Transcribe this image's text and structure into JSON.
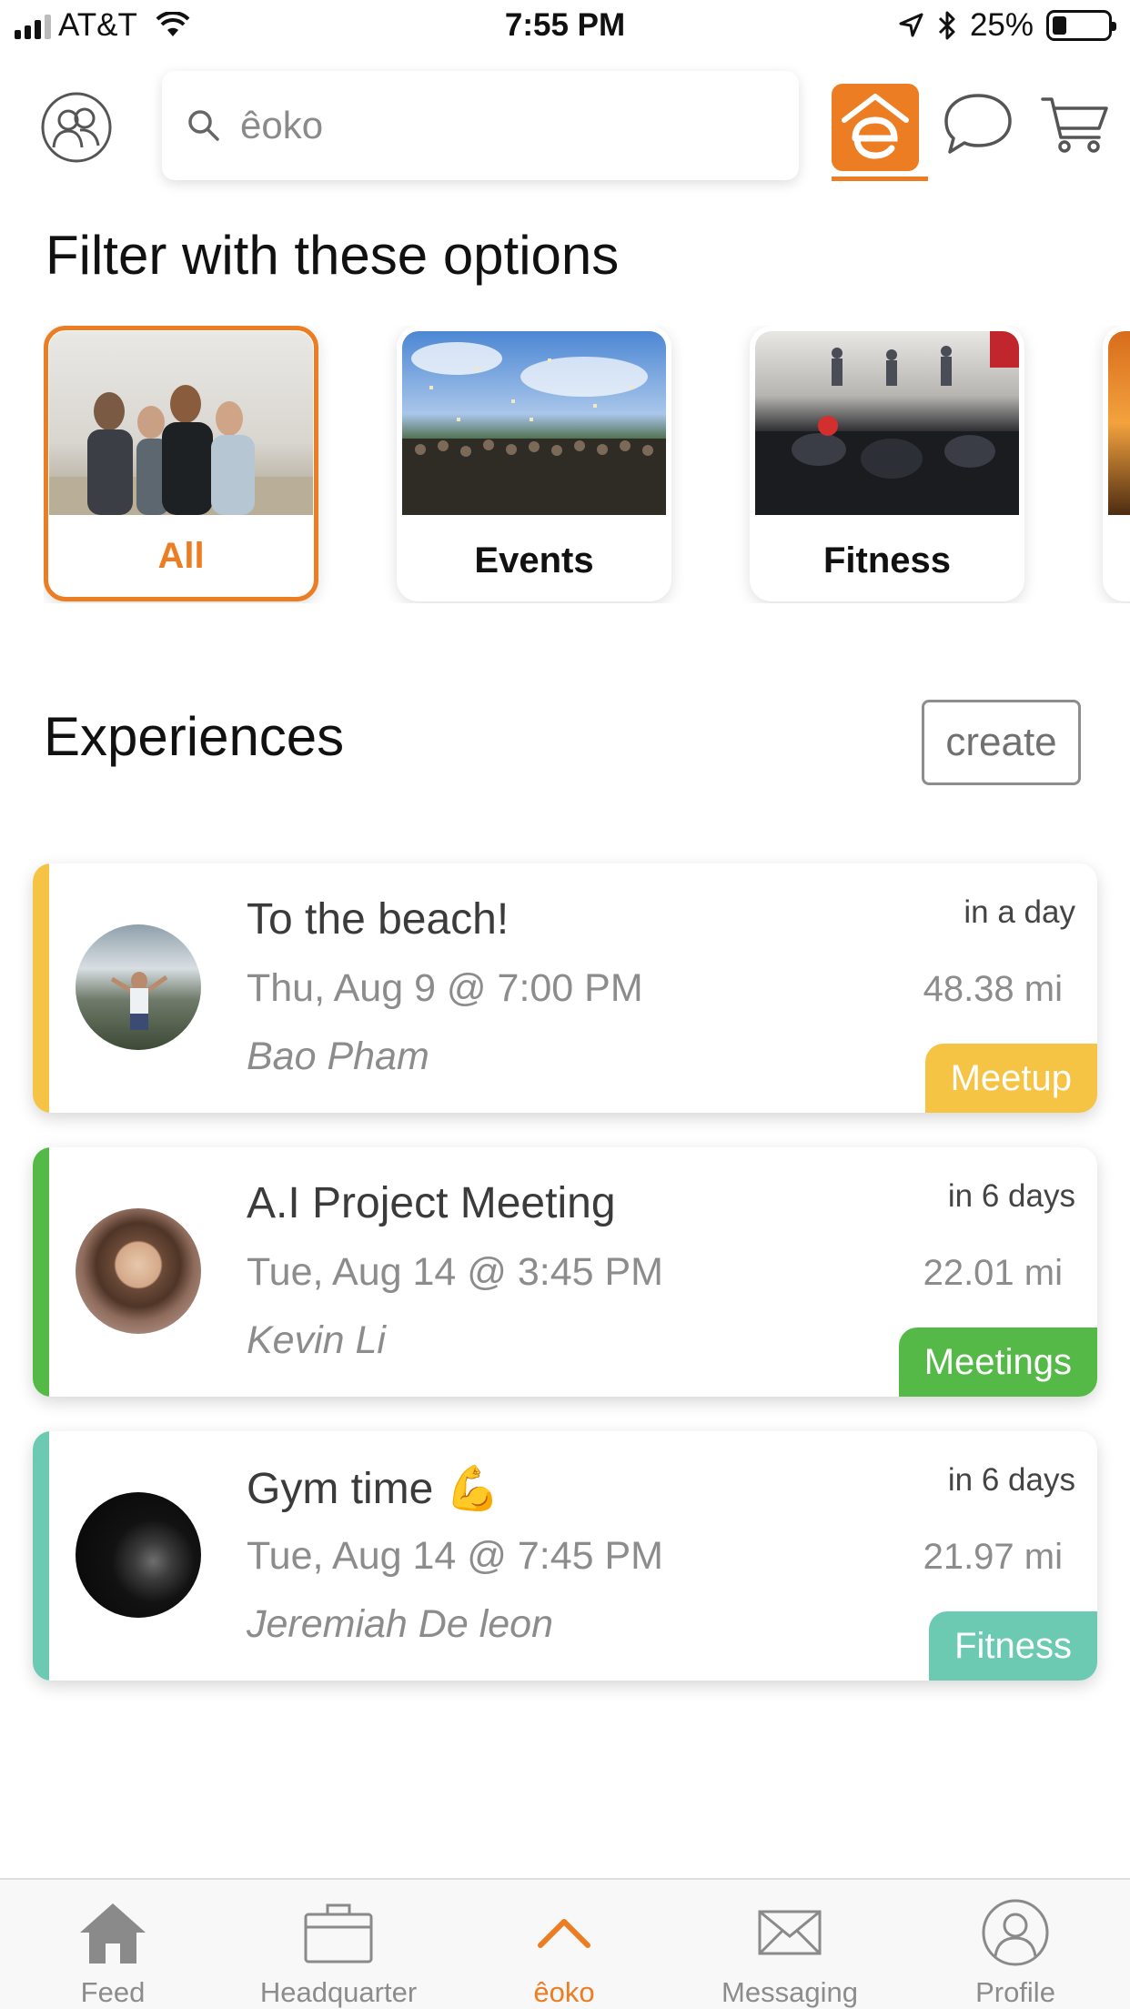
{
  "status_bar": {
    "carrier": "AT&T",
    "time": "7:55 PM",
    "battery": "25%",
    "battery_level": 0.25,
    "signal_bars": 3
  },
  "top_nav": {
    "search_placeholder": "êoko",
    "icons": [
      "friends-icon",
      "search-icon",
      "eoko-logo-icon",
      "chat-icon",
      "cart-icon"
    ],
    "accent_color": "#ec7d23"
  },
  "filter": {
    "title": "Filter with these options",
    "options": [
      {
        "label": "All",
        "selected": true
      },
      {
        "label": "Events",
        "selected": false
      },
      {
        "label": "Fitness",
        "selected": false
      }
    ]
  },
  "experiences": {
    "title": "Experiences",
    "create_label": "create",
    "items": [
      {
        "title": "To the beach!",
        "datetime": "Thu, Aug 9 @ 7:00 PM",
        "host": "Bao Pham",
        "when": "in a day",
        "distance": "48.38 mi",
        "tag": "Meetup",
        "color": "#f6c444"
      },
      {
        "title": "A.I Project Meeting",
        "datetime": "Tue, Aug 14 @ 3:45 PM",
        "host": "Kevin Li",
        "when": "in 6 days",
        "distance": "22.01 mi",
        "tag": "Meetings",
        "color": "#55b948"
      },
      {
        "title": "Gym time 💪",
        "datetime": "Tue, Aug 14 @ 7:45 PM",
        "host": "Jeremiah De leon",
        "when": "in 6 days",
        "distance": "21.97 mi",
        "tag": "Fitness",
        "color": "#6ccab3"
      }
    ]
  },
  "tab_bar": {
    "tabs": [
      {
        "label": "Feed",
        "icon": "home-icon",
        "active": false
      },
      {
        "label": "Headquarter",
        "icon": "briefcase-icon",
        "active": false
      },
      {
        "label": "êoko",
        "icon": "chevron-up-icon",
        "active": true
      },
      {
        "label": "Messaging",
        "icon": "envelope-icon",
        "active": false
      },
      {
        "label": "Profile",
        "icon": "profile-icon",
        "active": false
      }
    ]
  }
}
